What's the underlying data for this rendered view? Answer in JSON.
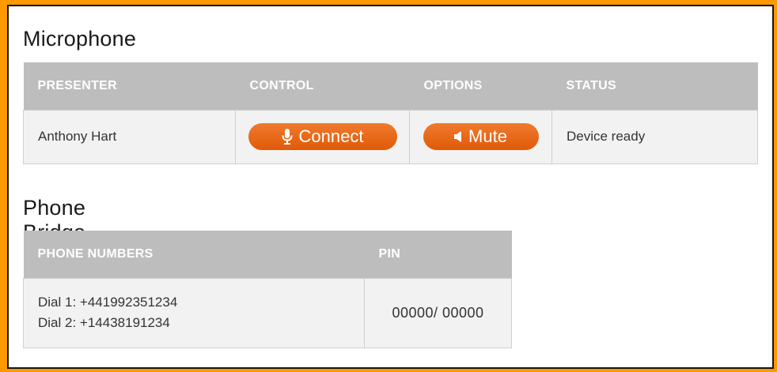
{
  "microphone": {
    "title": "Microphone",
    "headers": {
      "presenter": "PRESENTER",
      "control": "CONTROL",
      "options": "OPTIONS",
      "status": "STATUS"
    },
    "row": {
      "presenter": "Anthony Hart",
      "connect_label": "Connect",
      "connect_icon": "microphone-icon",
      "mute_label": "Mute",
      "mute_icon": "speaker-icon",
      "status": "Device ready"
    }
  },
  "bridge": {
    "title": "Phone Bridge Information",
    "headers": {
      "phone_numbers": "PHONE NUMBERS",
      "pin": "PIN"
    },
    "dial1": "Dial 1: +441992351234",
    "dial2": "Dial 2: +14438191234",
    "pin": "00000/ 00000"
  },
  "colors": {
    "accent": "#e8600f",
    "border": "#ff9900",
    "header_bg": "#bdbdbd",
    "cell_bg": "#f2f2f2"
  }
}
